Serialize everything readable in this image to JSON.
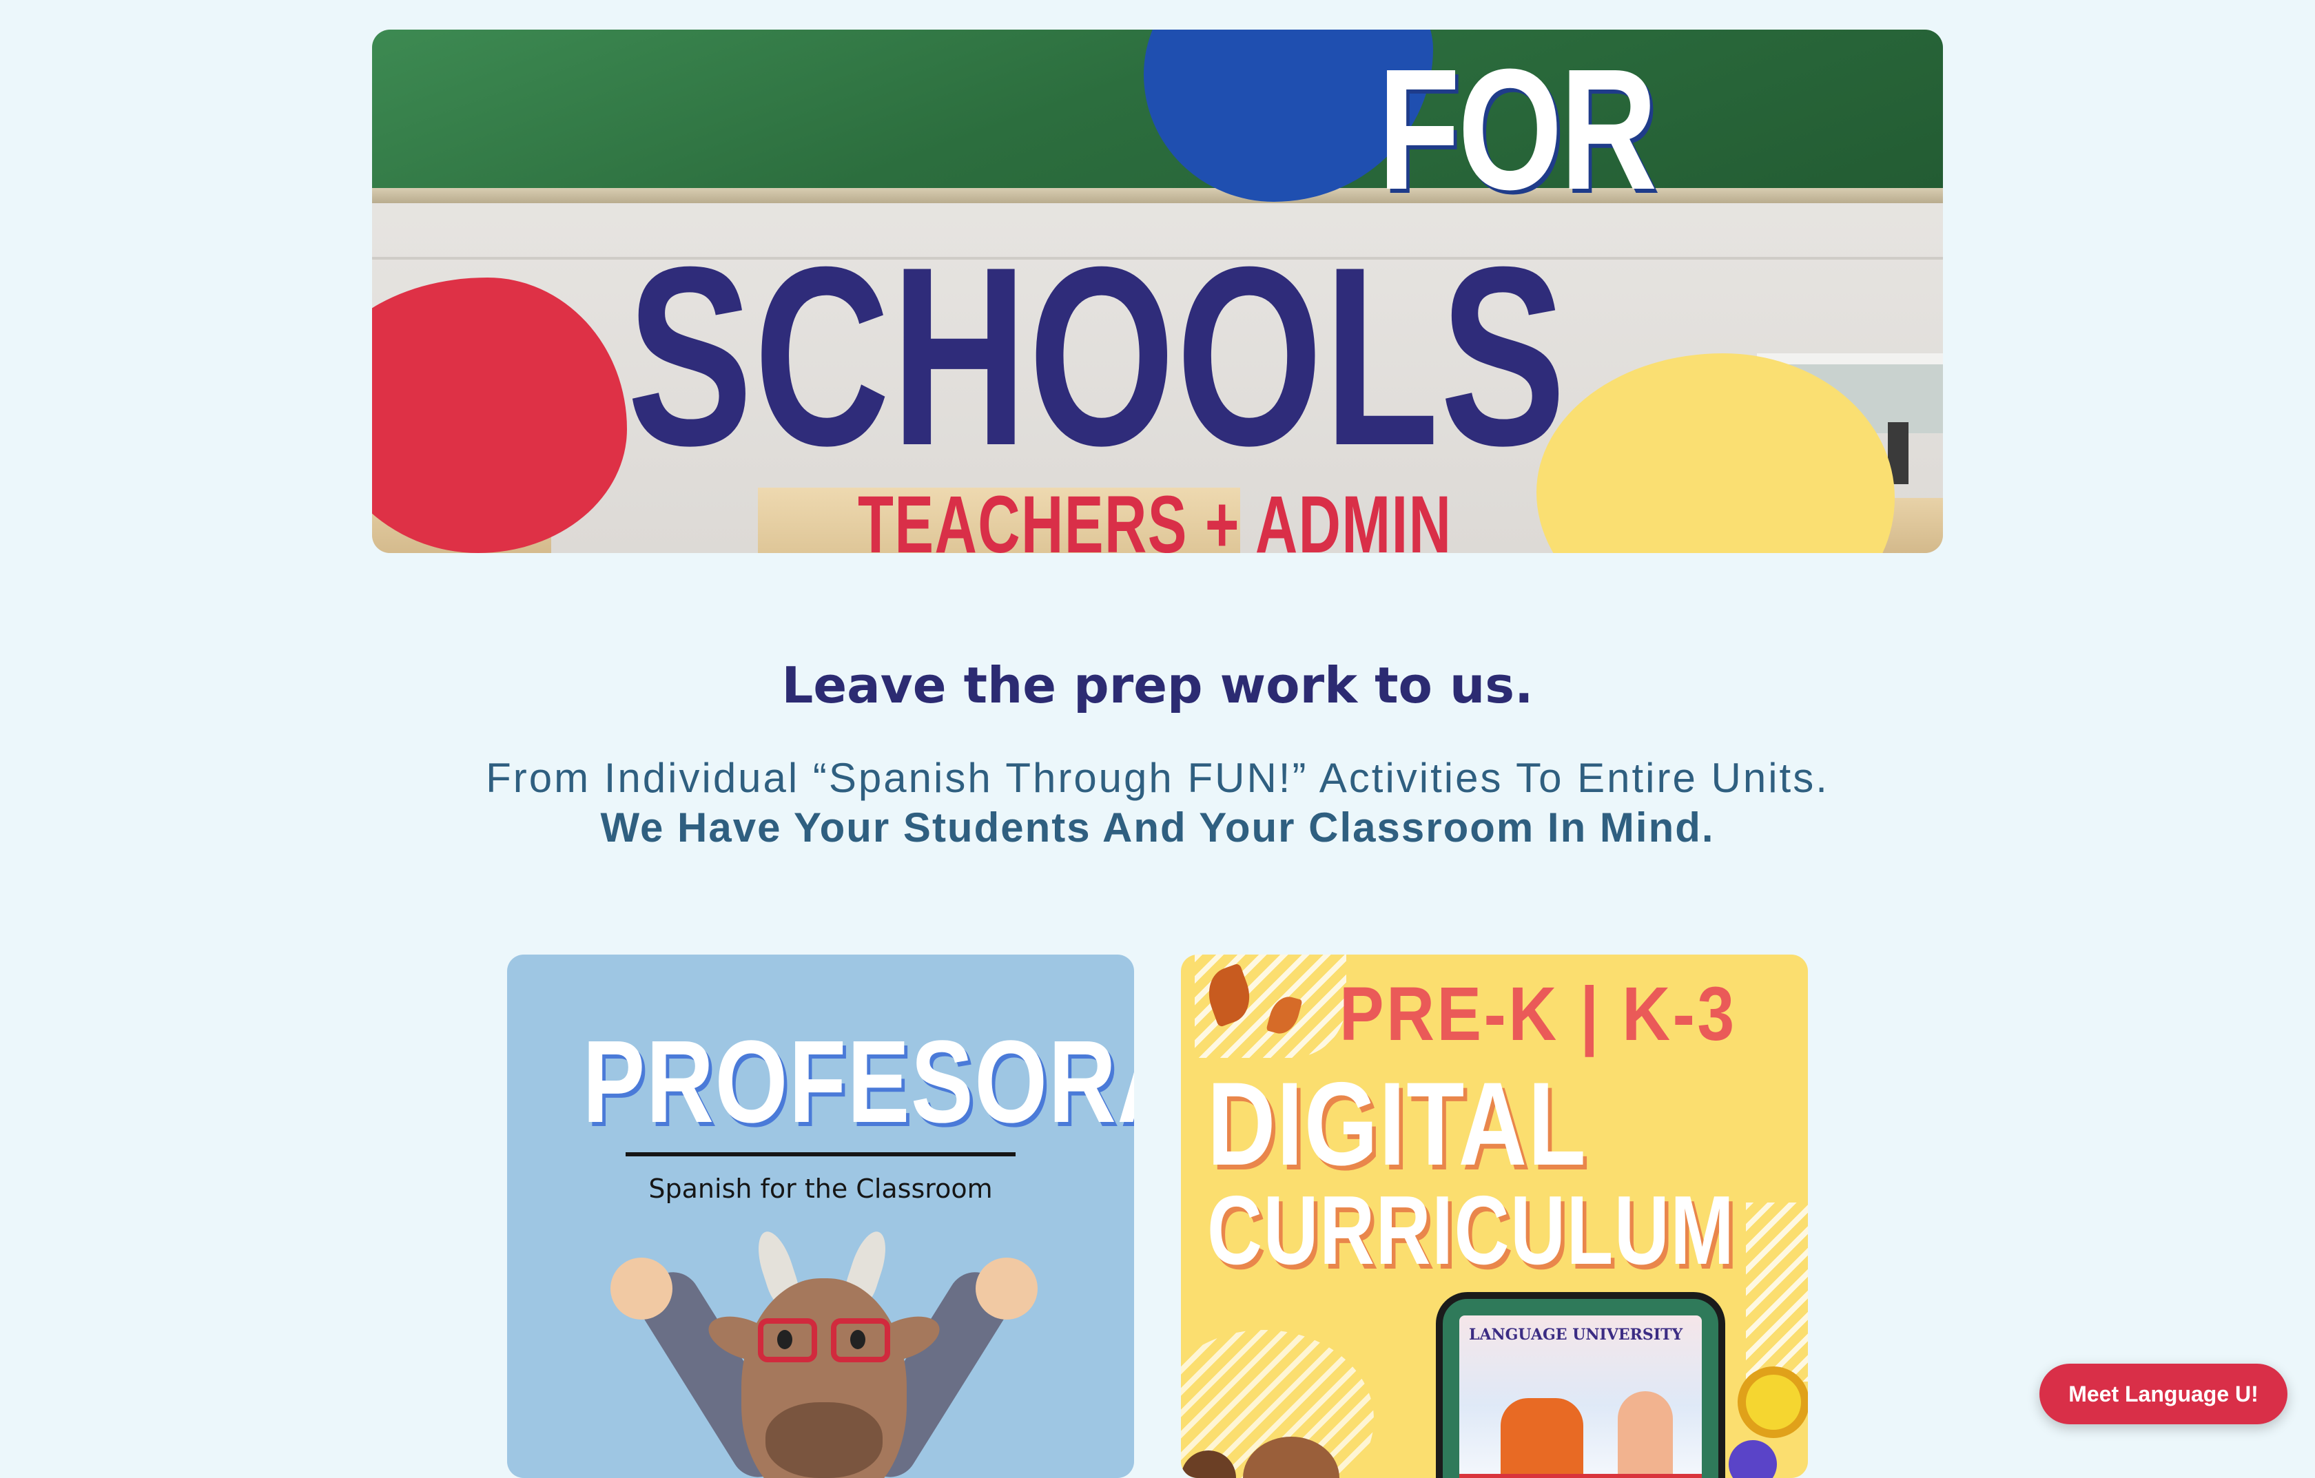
{
  "hero": {
    "line1": "FOR",
    "line2": "SCHOOLS",
    "line3": "TEACHERS + ADMIN"
  },
  "intro": {
    "headline": "Leave the prep work to us.",
    "subline1": "From Individual “Spanish Through FUN!” Activities To Entire Units.",
    "subline2": "We Have Your Students And Your Classroom In Mind."
  },
  "cards": [
    {
      "title": "PROFESORA",
      "subtitle": "Spanish for the Classroom",
      "background": "#9ec6e3"
    },
    {
      "grade": "PRE-K | K-3",
      "title_line1": "DIGITAL",
      "title_line2": "CURRICULUM",
      "tablet_label": "LANGUAGE UNIVERSITY",
      "background": "#fbde6f"
    }
  ],
  "chat_button": {
    "label": "Meet Language U!"
  },
  "colors": {
    "page_background": "#ecf7fb",
    "navy": "#2f2c7a",
    "brand_red": "#d92f48",
    "teal_text": "#2f5f80"
  }
}
